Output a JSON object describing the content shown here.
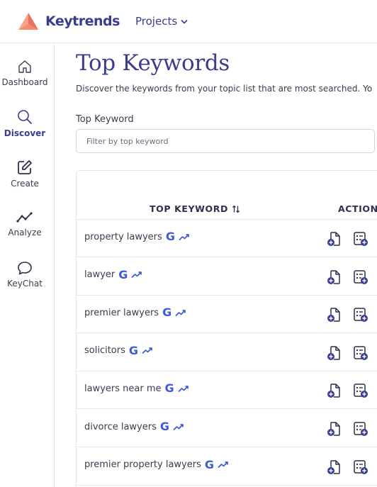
{
  "header": {
    "brand": "Keytrends",
    "projects_label": "Projects"
  },
  "sidebar": {
    "items": [
      {
        "label": "Dashboard",
        "icon": "home-icon"
      },
      {
        "label": "Discover",
        "icon": "search-icon",
        "active": true
      },
      {
        "label": "Create",
        "icon": "edit-icon"
      },
      {
        "label": "Analyze",
        "icon": "trend-icon"
      },
      {
        "label": "KeyChat",
        "icon": "chat-icon"
      }
    ]
  },
  "main": {
    "title": "Top Keywords",
    "subtitle": "Discover the keywords from your topic list that are most searched. Yo",
    "filter": {
      "label": "Top Keyword",
      "placeholder": "Filter by top keyword"
    },
    "table": {
      "columns": [
        "TOP KEYWORD",
        "ACTIONS"
      ],
      "rows": [
        {
          "keyword": "property lawyers"
        },
        {
          "keyword": "lawyer"
        },
        {
          "keyword": "premier lawyers"
        },
        {
          "keyword": "solicitors"
        },
        {
          "keyword": "lawyers near me"
        },
        {
          "keyword": "divorce lawyers"
        },
        {
          "keyword": "premier property lawyers"
        }
      ]
    }
  },
  "colors": {
    "brand": "#3a3c8f",
    "accent_google": "#3d5ad8",
    "logo": "#e8735a",
    "border": "#e4e4ea"
  }
}
